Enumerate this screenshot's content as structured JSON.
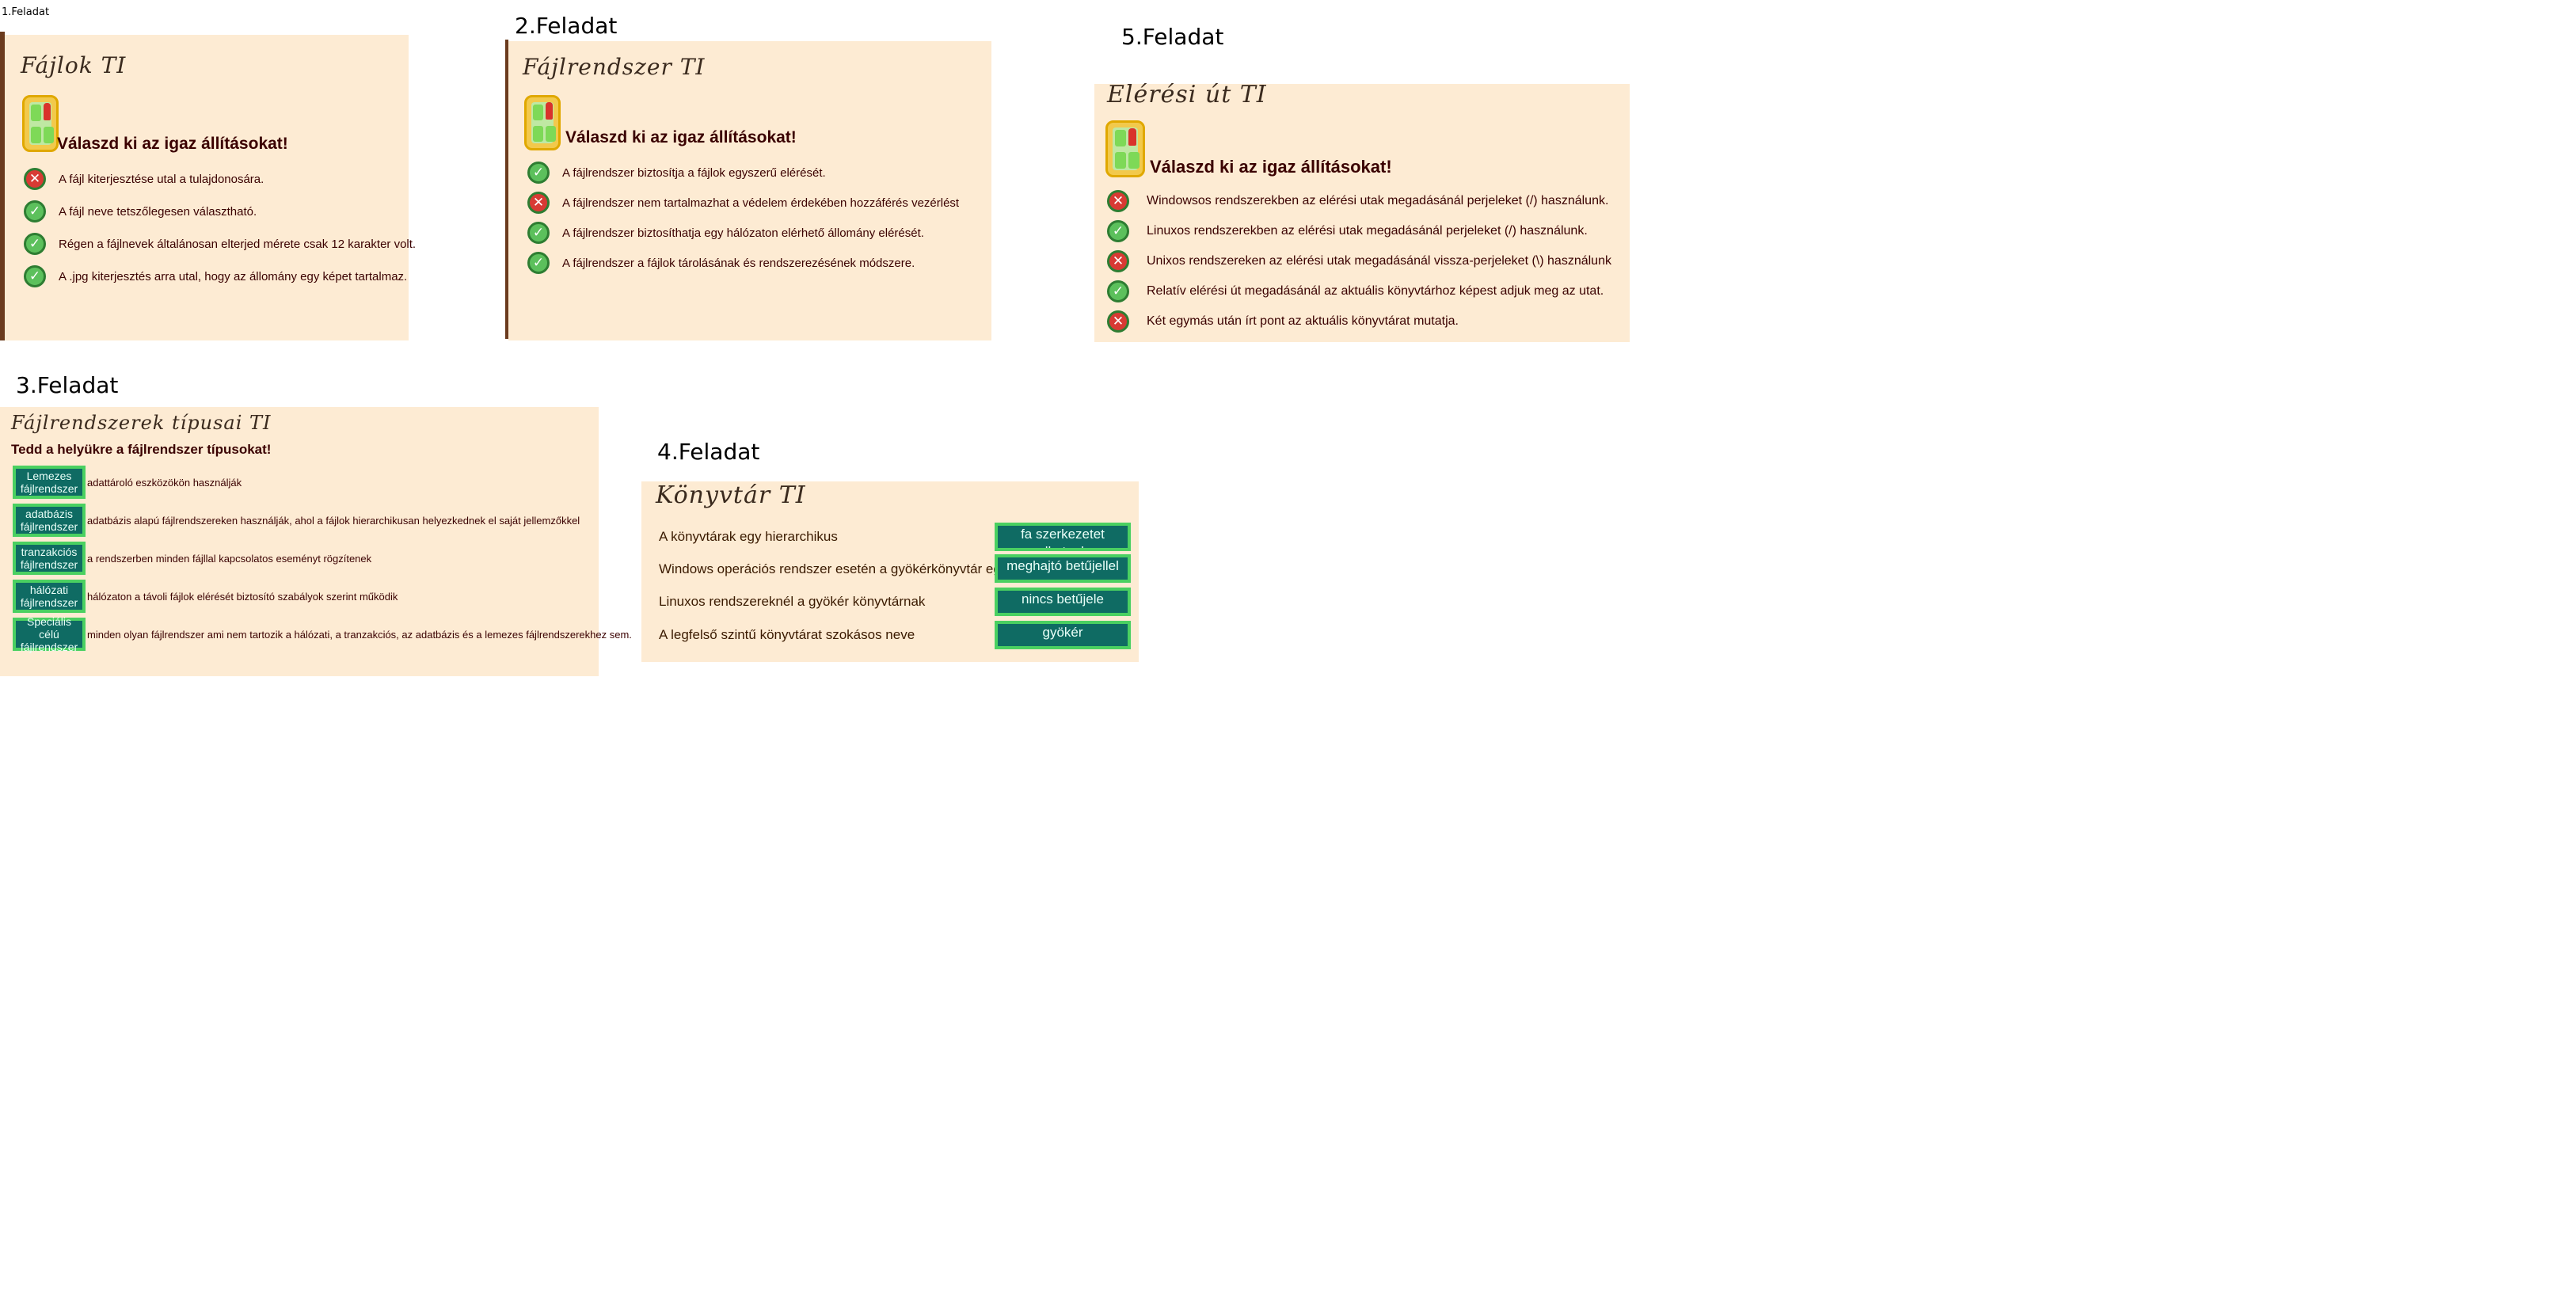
{
  "task1": {
    "label": "1.Feladat",
    "title": "Fájlok TI",
    "prompt": "Válaszd ki az igaz állításokat!",
    "items": [
      {
        "text": "A fájl kiterjesztése utal a tulajdonosára.",
        "icon": "cross-icon",
        "mark": "✕"
      },
      {
        "text": "A fájl neve tetszőlegesen választható.",
        "icon": "check-icon",
        "mark": "✓"
      },
      {
        "text": "Régen a fájlnevek általánosan elterjed mérete csak 12 karakter volt.",
        "icon": "check-icon",
        "mark": "✓"
      },
      {
        "text": "A .jpg kiterjesztés arra utal, hogy az állomány egy képet tartalmaz.",
        "icon": "check-icon",
        "mark": "✓"
      }
    ]
  },
  "task2": {
    "label": "2.Feladat",
    "title": "Fájlrendszer TI",
    "prompt": "Válaszd ki az igaz állításokat!",
    "items": [
      {
        "text": "A fájlrendszer biztosítja a fájlok egyszerű elérését.",
        "icon": "check-icon",
        "mark": "✓"
      },
      {
        "text": "A fájlrendszer nem tartalmazhat a védelem érdekében hozzáférés vezérlést",
        "icon": "cross-icon",
        "mark": "✕"
      },
      {
        "text": "A fájlrendszer biztosíthatja egy hálózaton elérhető állomány elérését.",
        "icon": "check-icon",
        "mark": "✓"
      },
      {
        "text": "A fájlrendszer a fájlok tárolásának és rendszerezésének módszere.",
        "icon": "check-icon",
        "mark": "✓"
      }
    ]
  },
  "task5": {
    "label": "5.Feladat",
    "title": "Elérési út TI",
    "prompt": "Válaszd ki az igaz állításokat!",
    "items": [
      {
        "text": "Windowsos rendszerekben az elérési utak megadásánál perjeleket (/) használunk.",
        "icon": "cross-icon",
        "mark": "✕"
      },
      {
        "text": "Linuxos rendszerekben az elérési utak megadásánál perjeleket (/) használunk.",
        "icon": "check-icon",
        "mark": "✓"
      },
      {
        "text": "Unixos rendszereken az elérési utak megadásánál vissza-perjeleket (\\) használunk",
        "icon": "cross-icon",
        "mark": "✕"
      },
      {
        "text": "Relatív elérési út megadásánál az aktuális könyvtárhoz képest adjuk meg az utat.",
        "icon": "check-icon",
        "mark": "✓"
      },
      {
        "text": "Két egymás után írt pont az aktuális könyvtárat mutatja.",
        "icon": "cross-icon",
        "mark": "✕"
      }
    ]
  },
  "task3": {
    "label": "3.Feladat",
    "title": "Fájlrendszerek típusai TI",
    "prompt": "Tedd a helyükre a fájlrendszer típusokat!",
    "items": [
      {
        "tag": "Lemezes fájlrendszer",
        "text": "adattároló eszközökön használják"
      },
      {
        "tag": "adatbázis fájlrendszer",
        "text": "adatbázis alapú fájlrendszereken használják, ahol a fájlok hierarchikusan helyezkednek el saját jellemzőkkel"
      },
      {
        "tag": "tranzakciós fájlrendszer",
        "text": "a rendszerben minden fájllal kapcsolatos eseményt rögzítenek"
      },
      {
        "tag": "hálózati fájlrendszer",
        "text": "hálózaton a távoli fájlok elérését biztosító szabályok szerint működik"
      },
      {
        "tag": "Speciális célú fájlrendszer",
        "text": "minden olyan fájlrendszer ami nem tartozik a hálózati, a tranzakciós, az adatbázis és a lemezes fájlrendszerekhez sem."
      }
    ]
  },
  "task4": {
    "label": "4.Feladat",
    "title": "Könyvtár TI",
    "items": [
      {
        "text": "A könyvtárak egy hierarchikus",
        "answer": "fa szerkezetet alkotnak"
      },
      {
        "text": "Windows operációs rendszer esetén a gyökérkönyvtár egy",
        "answer": "meghajtó betűjellel"
      },
      {
        "text": "Linuxos rendszereknél a gyökér könyvtárnak",
        "answer": "nincs betűjele"
      },
      {
        "text": "A legfelső szintű könyvtárat szokásos neve",
        "answer": "gyökér"
      }
    ]
  }
}
